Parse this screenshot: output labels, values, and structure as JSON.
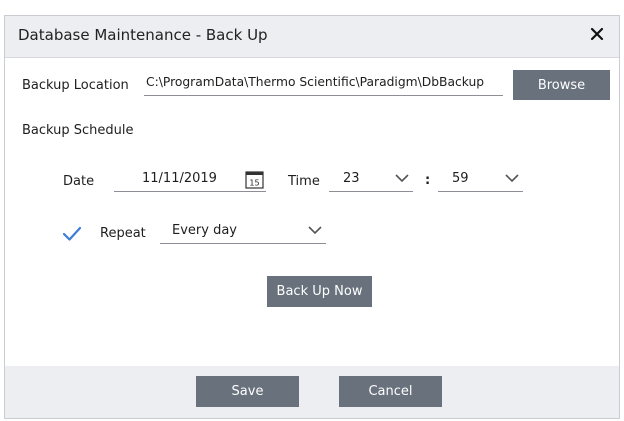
{
  "dialog": {
    "title": "Database Maintenance - Back Up"
  },
  "backup": {
    "location_label": "Backup Location",
    "location_value": "C:\\ProgramData\\Thermo Scientific\\Paradigm\\DbBackup",
    "browse_label": "Browse",
    "schedule_label": "Backup Schedule",
    "date_label": "Date",
    "date_value": "11/11/2019",
    "calendar_day": "15",
    "time_label": "Time",
    "hour_value": "23",
    "time_separator": ":",
    "minute_value": "59",
    "repeat_checked": true,
    "repeat_label": "Repeat",
    "repeat_value": "Every day",
    "backup_now_label": "Back Up Now"
  },
  "footer": {
    "save_label": "Save",
    "cancel_label": "Cancel"
  },
  "colors": {
    "button": "#68717c",
    "titlebar": "#eceef1",
    "accent": "#3b7dd8"
  }
}
